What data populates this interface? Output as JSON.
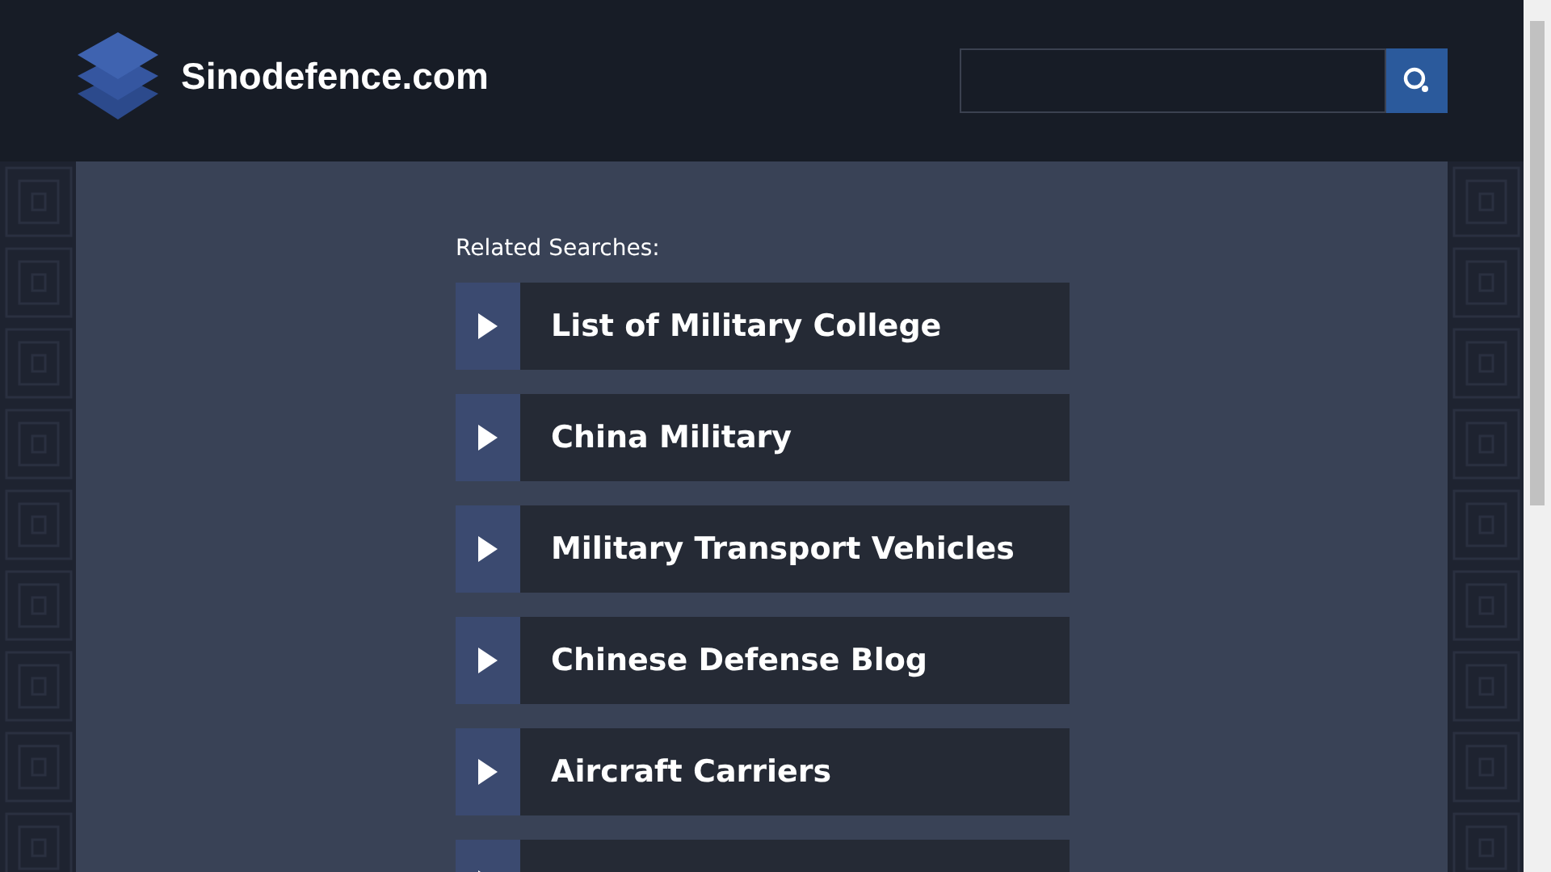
{
  "header": {
    "site_name": "Sinodefence.com"
  },
  "related": {
    "heading": "Related Searches:",
    "items": [
      {
        "label": "List of Military College"
      },
      {
        "label": "China Military"
      },
      {
        "label": "Military Transport Vehicles"
      },
      {
        "label": "Chinese Defense Blog"
      },
      {
        "label": "Aircraft Carriers"
      }
    ]
  }
}
